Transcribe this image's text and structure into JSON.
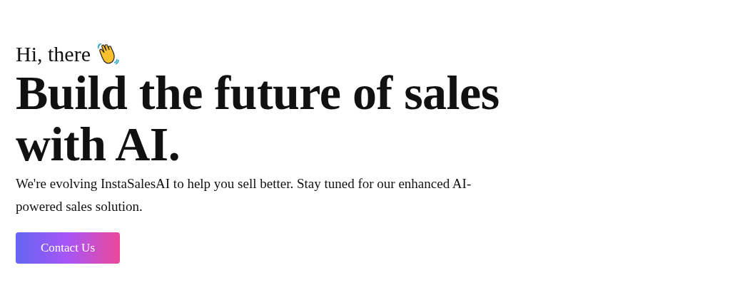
{
  "greeting": "Hi, there",
  "headline": "Build the future of sales with AI.",
  "description": "We're evolving InstaSalesAI to help you sell better. Stay tuned for our enhanced AI-powered sales solution.",
  "button": {
    "label": "Contact Us"
  }
}
